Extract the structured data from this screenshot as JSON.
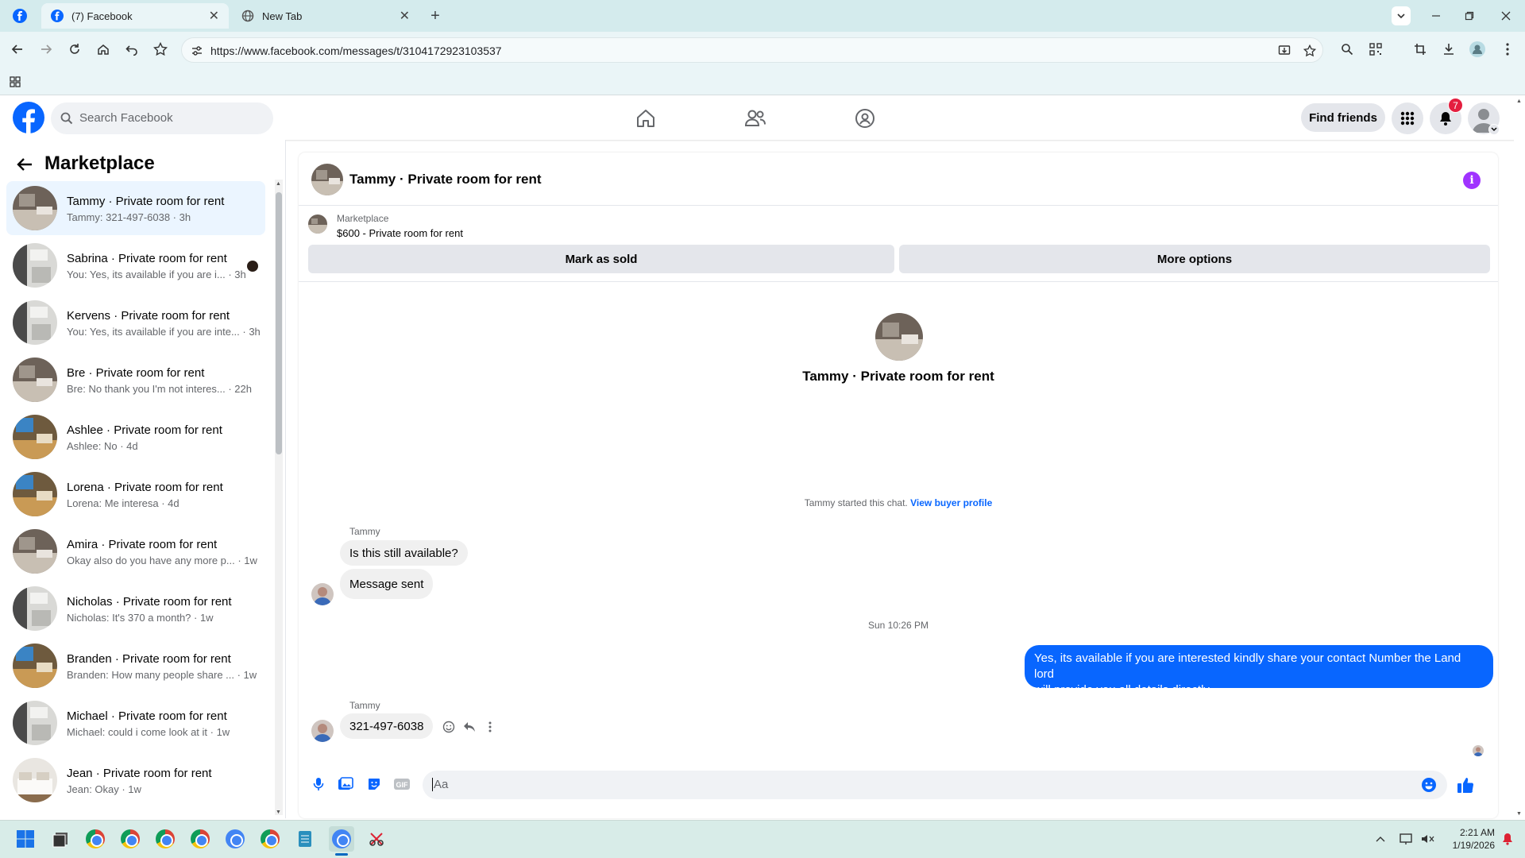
{
  "browser": {
    "tabs": [
      {
        "title": "(7) Facebook",
        "active": true
      },
      {
        "title": "New Tab",
        "active": false
      }
    ],
    "url": "https://www.facebook.com/messages/t/3104172923103537"
  },
  "header": {
    "search_placeholder": "Search Facebook",
    "find_friends": "Find friends",
    "notification_count": "7"
  },
  "sidebar": {
    "title": "Marketplace",
    "conversations": [
      {
        "name": "Tammy · Private room for rent",
        "preview": "Tammy: 321-497-6038 · 3h",
        "selected": true,
        "thumb": "room-dark"
      },
      {
        "name": "Sabrina · Private room for rent",
        "preview": "You: Yes, its available if you are i... · 3h",
        "unread": true,
        "thumb": "bath"
      },
      {
        "name": "Kervens · Private room for rent",
        "preview": "You: Yes, its available if you are inte... · 3h",
        "thumb": "bath"
      },
      {
        "name": "Bre · Private room for rent",
        "preview": "Bre: No thank you I'm not interes... · 22h",
        "thumb": "room-dark"
      },
      {
        "name": "Ashlee · Private room for rent",
        "preview": "Ashlee: No · 4d",
        "thumb": "room-blue"
      },
      {
        "name": "Lorena · Private room for rent",
        "preview": "Lorena: Me interesa · 4d",
        "thumb": "room-blue"
      },
      {
        "name": "Amira · Private room for rent",
        "preview": "Okay also do you have any more p... · 1w",
        "thumb": "room-dark"
      },
      {
        "name": "Nicholas · Private room for rent",
        "preview": "Nicholas: It's 370 a month? · 1w",
        "thumb": "bath"
      },
      {
        "name": "Branden · Private room for rent",
        "preview": "Branden: How many people share ... · 1w",
        "thumb": "room-blue"
      },
      {
        "name": "Michael · Private room for rent",
        "preview": "Michael: could i come look at it · 1w",
        "thumb": "bath"
      },
      {
        "name": "Jean · Private room for rent",
        "preview": "Jean: Okay · 1w",
        "thumb": "bed"
      }
    ]
  },
  "chat": {
    "header_title": "Tammy · Private room for rent",
    "listing_source": "Marketplace",
    "listing_title": "$600 - Private room for rent",
    "mark_sold_label": "Mark as sold",
    "more_options_label": "More options",
    "hero_title": "Tammy · Private room for rent",
    "started_text": "Tammy started this chat.",
    "buyer_profile_link": "View buyer profile",
    "sender_name_1": "Tammy",
    "msg_1": "Is this still available?",
    "msg_2": "Message sent",
    "timestamp": "Sun 10:26 PM",
    "own_msg_line1": "Yes, its available if you are interested kindly share your contact Number the Land lord",
    "own_msg_line2": "will provide you all details directly.",
    "sender_name_2": "Tammy",
    "msg_3": "321-497-6038",
    "composer_placeholder": "Aa"
  },
  "taskbar": {
    "time": "2:21 AM",
    "date": "1/19/2026"
  },
  "colors": {
    "fb_blue": "#0866ff",
    "selected_bg": "#ebf5ff",
    "info_purple": "#a033ff",
    "badge_red": "#e41e3f",
    "tab_strip": "#d4ebed"
  }
}
